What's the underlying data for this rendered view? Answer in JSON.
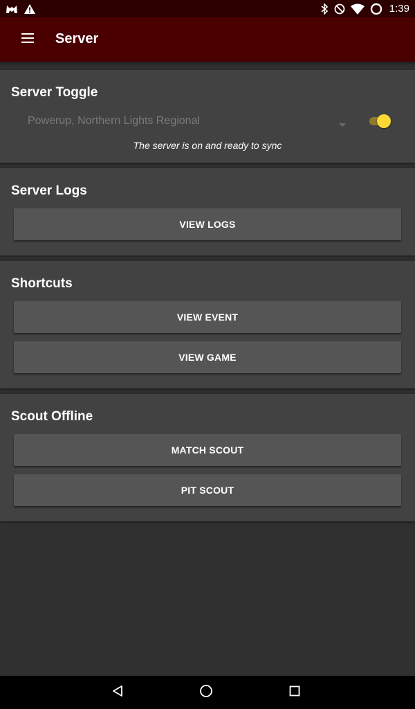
{
  "status_bar": {
    "time": "1:39",
    "icons": [
      "app-notification-icon",
      "warning-icon",
      "bluetooth-icon",
      "do-not-disturb-icon",
      "wifi-icon",
      "battery-icon"
    ]
  },
  "app_bar": {
    "title": "Server",
    "menu_icon": "menu-icon"
  },
  "server_toggle": {
    "title": "Server Toggle",
    "event_selected": "Powerup, Northern Lights Regional",
    "switch_on": true,
    "status_message": "The server is on and ready to sync"
  },
  "server_logs": {
    "title": "Server Logs",
    "view_logs_label": "VIEW LOGS"
  },
  "shortcuts": {
    "title": "Shortcuts",
    "view_event_label": "VIEW EVENT",
    "view_game_label": "VIEW GAME"
  },
  "scout_offline": {
    "title": "Scout Offline",
    "match_scout_label": "MATCH SCOUT",
    "pit_scout_label": "PIT SCOUT"
  },
  "nav_bar": {
    "icons": [
      "back-icon",
      "home-icon",
      "recents-icon"
    ]
  },
  "colors": {
    "status_bar": "#2d0000",
    "app_bar": "#4a0000",
    "background": "#303030",
    "card": "#424242",
    "button": "#555555",
    "switch_thumb": "#fdd835"
  }
}
